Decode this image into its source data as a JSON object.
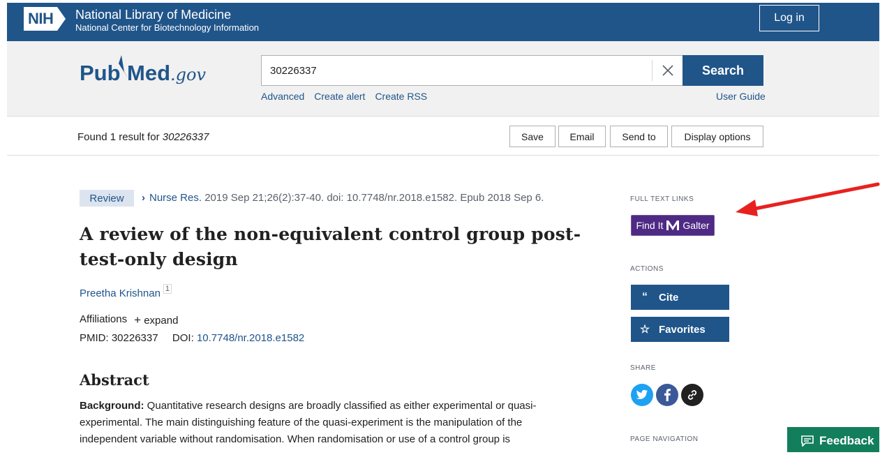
{
  "nih": {
    "logo_text": "NIH",
    "title": "National Library of Medicine",
    "subtitle": "National Center for Biotechnology Information",
    "login_label": "Log in"
  },
  "pubmed": {
    "logo_pub": "Pub",
    "logo_med": "Med",
    "logo_gov": ".gov"
  },
  "search": {
    "value": "30226337",
    "button_label": "Search",
    "links": [
      "Advanced",
      "Create alert",
      "Create RSS"
    ],
    "user_guide": "User Guide"
  },
  "results": {
    "found_prefix": "Found 1 result for ",
    "query": "30226337",
    "toolbar": [
      "Save",
      "Email",
      "Send to",
      "Display options"
    ]
  },
  "article": {
    "badge": "Review",
    "journal": "Nurse Res.",
    "citation_rest": " 2019 Sep 21;26(2):37-40. doi: 10.7748/nr.2018.e1582. Epub 2018 Sep 6.",
    "title_line1": "A review of the non-equivalent control group post-",
    "title_line2": "test-only design",
    "author": "Preetha Krishnan",
    "author_affil_num": "1",
    "affiliations_label": "Affiliations",
    "expand_label": "expand",
    "pmid_label": "PMID: 30226337",
    "doi_label": "DOI: ",
    "doi_value": "10.7748/nr.2018.e1582",
    "abstract_heading": "Abstract",
    "background_label": "Background:",
    "abstract_text": " Quantitative research designs are broadly classified as either experimental or quasi-experimental. The main distinguishing feature of the quasi-experiment is the manipulation of the independent variable without randomisation. When randomisation or use of a control group is"
  },
  "sidebar": {
    "full_text_label": "FULL TEXT LINKS",
    "findit_label": "Find It",
    "findit_brand": "Galter",
    "actions_label": "ACTIONS",
    "cite_label": "Cite",
    "favorites_label": "Favorites",
    "share_label": "SHARE",
    "page_nav_label": "PAGE NAVIGATION",
    "share_icons": [
      "twitter-icon",
      "facebook-icon",
      "link-icon"
    ]
  },
  "feedback_label": "Feedback",
  "colors": {
    "nih_blue": "#20558a",
    "galter_purple": "#4e2a84",
    "feedback_green": "#137e5c",
    "annotation_red": "#e8211f"
  }
}
